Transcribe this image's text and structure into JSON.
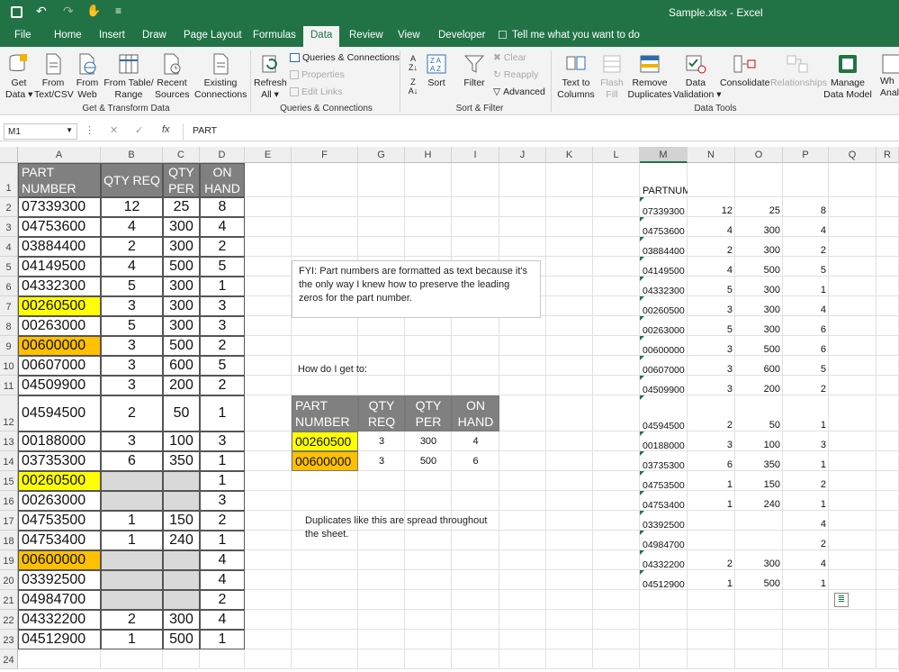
{
  "window": {
    "title": "Sample.xlsx  -  Excel"
  },
  "tabs": [
    "File",
    "Home",
    "Insert",
    "Draw",
    "Page Layout",
    "Formulas",
    "Data",
    "Review",
    "View",
    "Developer"
  ],
  "tell_me": "Tell me what you want to do",
  "ribbon": {
    "get_data": "Get\nData ▾",
    "from_text": "From\nText/CSV",
    "from_web": "From\nWeb",
    "from_table": "From Table/\nRange",
    "recent_sources": "Recent\nSources",
    "existing_connections": "Existing\nConnections",
    "refresh_all": "Refresh\nAll ▾",
    "queries_connections": "Queries & Connections",
    "properties": "Properties",
    "edit_links": "Edit Links",
    "sort": "Sort",
    "filter": "Filter",
    "clear": "Clear",
    "reapply": "Reapply",
    "advanced": "Advanced",
    "text_to_columns": "Text to\nColumns",
    "flash_fill": "Flash\nFill",
    "remove_duplicates": "Remove\nDuplicates",
    "data_validation": "Data\nValidation ▾",
    "consolidate": "Consolidate",
    "relationships": "Relationships",
    "manage_data_model": "Manage\nData Model",
    "whatif": "Wh\nAnal",
    "groups": {
      "get_transform": "Get & Transform Data",
      "queries": "Queries & Connections",
      "sort_filter": "Sort & Filter",
      "data_tools": "Data Tools"
    }
  },
  "formula_bar": {
    "name_box": "M1",
    "fx": "fx",
    "value": "PART"
  },
  "columns": [
    "A",
    "B",
    "C",
    "D",
    "E",
    "F",
    "G",
    "H",
    "I",
    "J",
    "K",
    "L",
    "M",
    "N",
    "O",
    "P",
    "Q",
    "R"
  ],
  "rows": [
    "1",
    "2",
    "3",
    "4",
    "5",
    "6",
    "7",
    "8",
    "9",
    "10",
    "11",
    "12",
    "13",
    "14",
    "15",
    "16",
    "17",
    "18",
    "19",
    "20",
    "21",
    "22",
    "23",
    "24"
  ],
  "header_a": "PART\nNUMBER",
  "header_b": "QTY REQ",
  "header_c": "QTY\nPER",
  "header_d": "ON\nHAND",
  "left_table": [
    [
      "07339300",
      "12",
      "25",
      "8"
    ],
    [
      "04753600",
      "4",
      "300",
      "4"
    ],
    [
      "03884400",
      "2",
      "300",
      "2"
    ],
    [
      "04149500",
      "4",
      "500",
      "5"
    ],
    [
      "04332300",
      "5",
      "300",
      "1"
    ],
    [
      "00260500",
      "3",
      "300",
      "3"
    ],
    [
      "00263000",
      "5",
      "300",
      "3"
    ],
    [
      "00600000",
      "3",
      "500",
      "2"
    ],
    [
      "00607000",
      "3",
      "600",
      "5"
    ],
    [
      "04509900",
      "3",
      "200",
      "2"
    ],
    [
      "04594500",
      "2",
      "50",
      "1"
    ],
    [
      "00188000",
      "3",
      "100",
      "3"
    ],
    [
      "03735300",
      "6",
      "350",
      "1"
    ],
    [
      "00260500",
      "",
      "",
      "1"
    ],
    [
      "00263000",
      "",
      "",
      "3"
    ],
    [
      "04753500",
      "1",
      "150",
      "2"
    ],
    [
      "04753400",
      "1",
      "240",
      "1"
    ],
    [
      "00600000",
      "",
      "",
      "4"
    ],
    [
      "03392500",
      "",
      "",
      "4"
    ],
    [
      "04984700",
      "",
      "",
      "2"
    ],
    [
      "04332200",
      "2",
      "300",
      "4"
    ],
    [
      "04512900",
      "1",
      "500",
      "1"
    ]
  ],
  "fyi_text": "FYI: Part numbers are formatted as text because it's the only way I knew how to preserve the leading zeros for the part number.",
  "how_text": "How do I get to:",
  "target_headers": [
    "PART\nNUMBER",
    "QTY\nREQ",
    "QTY\nPER",
    "ON\nHAND"
  ],
  "target_rows": [
    [
      "00260500",
      "3",
      "300",
      "4"
    ],
    [
      "00600000",
      "3",
      "500",
      "6"
    ]
  ],
  "dup_text": "Duplicates like this are spread throughout the sheet.",
  "right_header": "PARTNUMBER",
  "right_table": [
    [
      "07339300",
      "12",
      "25",
      "8"
    ],
    [
      "04753600",
      "4",
      "300",
      "4"
    ],
    [
      "03884400",
      "2",
      "300",
      "2"
    ],
    [
      "04149500",
      "4",
      "500",
      "5"
    ],
    [
      "04332300",
      "5",
      "300",
      "1"
    ],
    [
      "00260500",
      "3",
      "300",
      "4"
    ],
    [
      "00263000",
      "5",
      "300",
      "6"
    ],
    [
      "00600000",
      "3",
      "500",
      "6"
    ],
    [
      "00607000",
      "3",
      "600",
      "5"
    ],
    [
      "04509900",
      "3",
      "200",
      "2"
    ],
    [
      "04594500",
      "2",
      "50",
      "1"
    ],
    [
      "00188000",
      "3",
      "100",
      "3"
    ],
    [
      "03735300",
      "6",
      "350",
      "1"
    ],
    [
      "04753500",
      "1",
      "150",
      "2"
    ],
    [
      "04753400",
      "1",
      "240",
      "1"
    ],
    [
      "03392500",
      "",
      "",
      "4"
    ],
    [
      "04984700",
      "",
      "",
      "2"
    ],
    [
      "04332200",
      "2",
      "300",
      "4"
    ],
    [
      "04512900",
      "1",
      "500",
      "1"
    ]
  ],
  "colors": {
    "excel_green": "#217346",
    "yellow": "#ffff00",
    "orange": "#ffc000",
    "header_gray": "#808080",
    "gray_fill": "#d9d9d9"
  }
}
